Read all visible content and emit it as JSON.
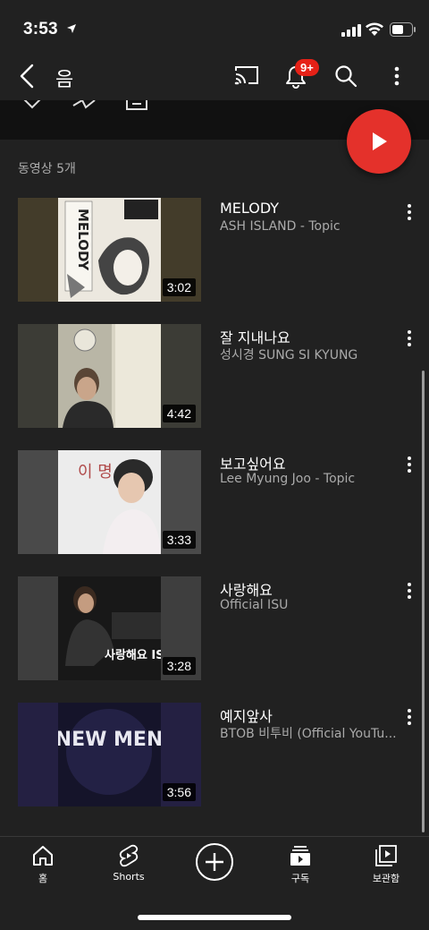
{
  "status": {
    "time": "3:53"
  },
  "header": {
    "title": "음",
    "notification_count": "9+"
  },
  "section": {
    "label": "동영상 5개"
  },
  "videos": [
    {
      "title": "MELODY",
      "channel": "ASH ISLAND - Topic",
      "duration": "3:02"
    },
    {
      "title": "잘 지내나요",
      "channel": "성시경 SUNG SI KYUNG",
      "duration": "4:42"
    },
    {
      "title": "보고싶어요",
      "channel": "Lee Myung Joo  - Topic",
      "duration": "3:33"
    },
    {
      "title": "사랑해요",
      "channel": "Official ISU",
      "duration": "3:28"
    },
    {
      "title": "예지앞사",
      "channel": "BTOB 비투비 (Official YouTu...",
      "duration": "3:56"
    }
  ],
  "thumbnails": [
    {
      "bg": "#433c2a",
      "text": "MELODY"
    },
    {
      "bg": "#3c3c36",
      "text": ""
    },
    {
      "bg": "#4a4a4a",
      "text": "이 명 주"
    },
    {
      "bg": "#3e3e3e",
      "text": "사랑해요 ISU"
    },
    {
      "bg": "#242042",
      "text": "NEW MEN"
    }
  ],
  "nav": {
    "home": "홈",
    "shorts": "Shorts",
    "subscriptions": "구독",
    "library": "보관함"
  },
  "colors": {
    "background": "#212121",
    "accent": "#e4312b",
    "secondary_text": "#aaaaaa"
  }
}
